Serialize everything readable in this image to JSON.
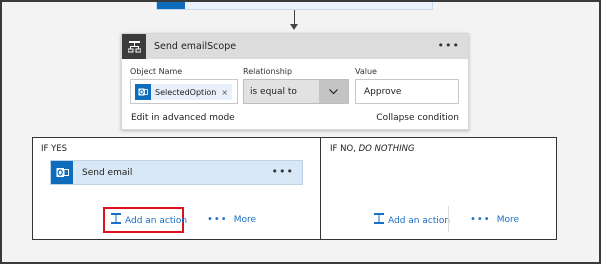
{
  "condition": {
    "title": "Send emailScope",
    "menu_dots": "•••",
    "object_name_label": "Object Name",
    "relationship_label": "Relationship",
    "value_label": "Value",
    "object_token": "SelectedOption",
    "token_remove": "×",
    "relationship_value": "is equal to",
    "value": "Approve",
    "edit_advanced": "Edit in advanced mode",
    "collapse": "Collapse condition"
  },
  "branches": {
    "yes_label": "IF YES",
    "no_label_prefix": "IF NO,",
    "no_label_em": "DO NOTHING",
    "yes": {
      "email_card_title": "Send email",
      "menu_dots": "•••",
      "add_action": "Add an action",
      "more": "More",
      "more_dots": "•••"
    },
    "no": {
      "add_action": "Add an action",
      "more": "More",
      "more_dots": "•••"
    }
  },
  "colors": {
    "accent": "#0f6cbd",
    "link": "#1a6fc4",
    "highlight": "#e0101a"
  },
  "icons": {
    "condition": "condition-icon",
    "outlook": "outlook-icon",
    "add_action": "add-action-icon",
    "chevron": "chevron-down-icon"
  }
}
